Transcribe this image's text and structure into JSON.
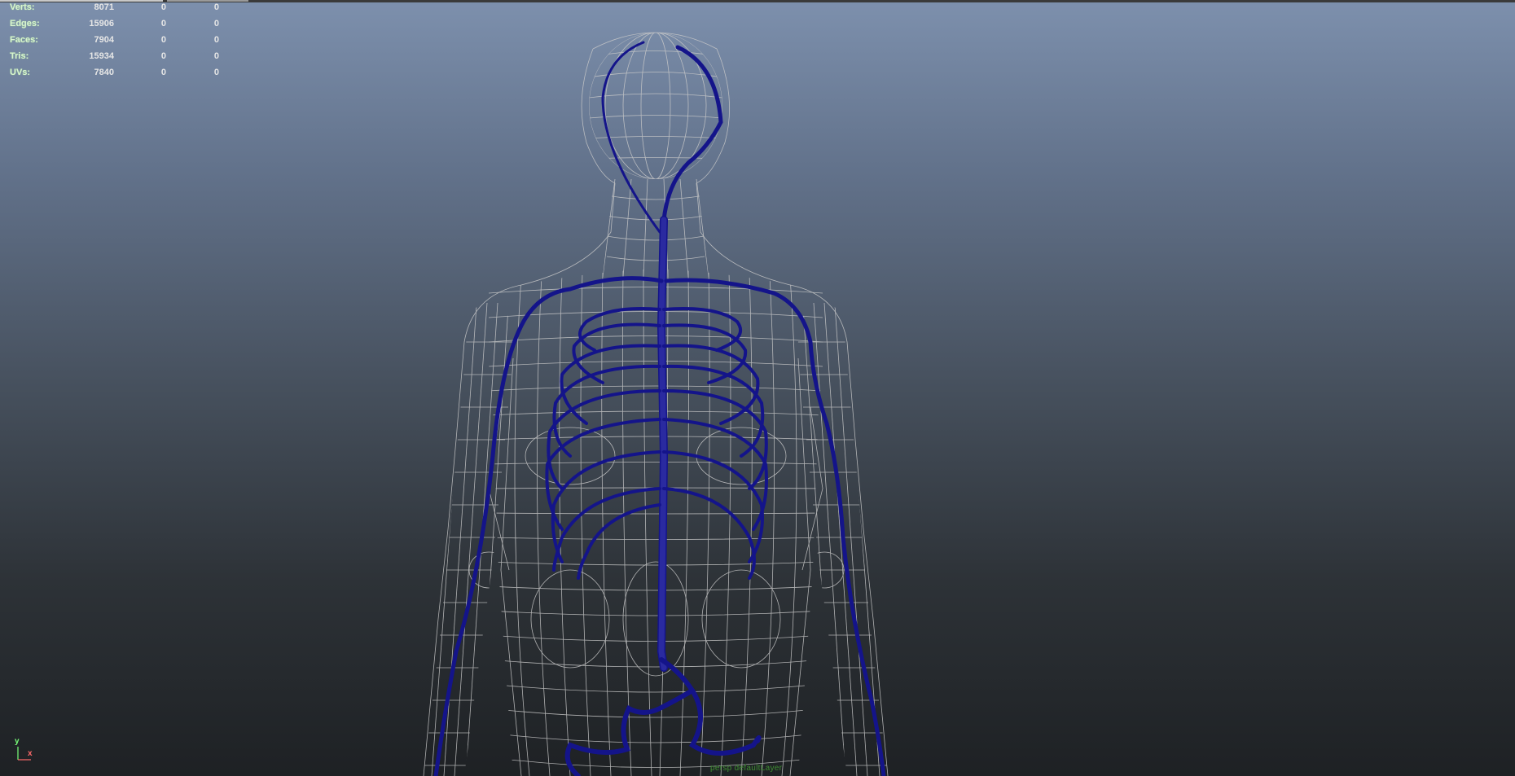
{
  "viewport": {
    "background_top": "#7d90ad",
    "background_bottom": "#1e2124",
    "wire_color": "#c9c9c9",
    "curve_color": "#14148a"
  },
  "hud": {
    "rows": [
      {
        "label": "Verts:",
        "values": [
          "8071",
          "0",
          "0"
        ]
      },
      {
        "label": "Edges:",
        "values": [
          "15906",
          "0",
          "0"
        ]
      },
      {
        "label": "Faces:",
        "values": [
          "7904",
          "0",
          "0"
        ]
      },
      {
        "label": "Tris:",
        "values": [
          "15934",
          "0",
          "0"
        ]
      },
      {
        "label": "UVs:",
        "values": [
          "7840",
          "0",
          "0"
        ]
      }
    ]
  },
  "axis": {
    "y_label": "y",
    "x_label": "x",
    "y_color": "#79ff79",
    "x_color": "#ff6a6a",
    "icon": "axis-gizmo-icon"
  },
  "layer_label": "persp  defaultLayer"
}
